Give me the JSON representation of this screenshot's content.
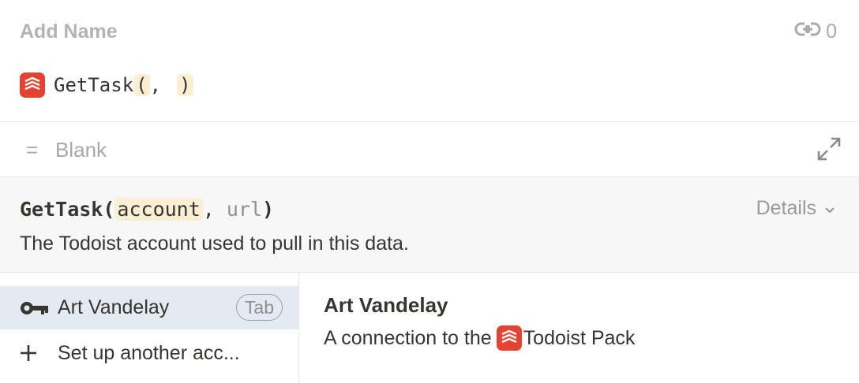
{
  "header": {
    "name_placeholder": "Add Name",
    "link_count": "0"
  },
  "formula": {
    "function_name": "GetTask",
    "open_paren": "(",
    "separator": ",",
    "close_paren": ")"
  },
  "result": {
    "equals": "=",
    "value": "Blank"
  },
  "help": {
    "function_name": "GetTask",
    "open_paren": "(",
    "active_arg": "account",
    "separator": ", ",
    "next_arg": "url",
    "close_paren": ")",
    "description": "The Todoist account used to pull in this data.",
    "details_label": "Details"
  },
  "accounts": {
    "items": [
      {
        "label": "Art Vandelay",
        "hint": "Tab"
      },
      {
        "label": "Set up another acc..."
      }
    ]
  },
  "detail": {
    "title": "Art Vandelay",
    "subtitle_prefix": "A connection to the",
    "pack_name": "Todoist Pack"
  },
  "colors": {
    "todoist_red": "#e44332",
    "selection_bg": "#e3eaf2",
    "highlight": "#fbefd3"
  },
  "icons": [
    "link-icon",
    "todoist-logo-icon",
    "expand-icon",
    "chevron-down-icon",
    "key-icon",
    "plus-icon"
  ]
}
